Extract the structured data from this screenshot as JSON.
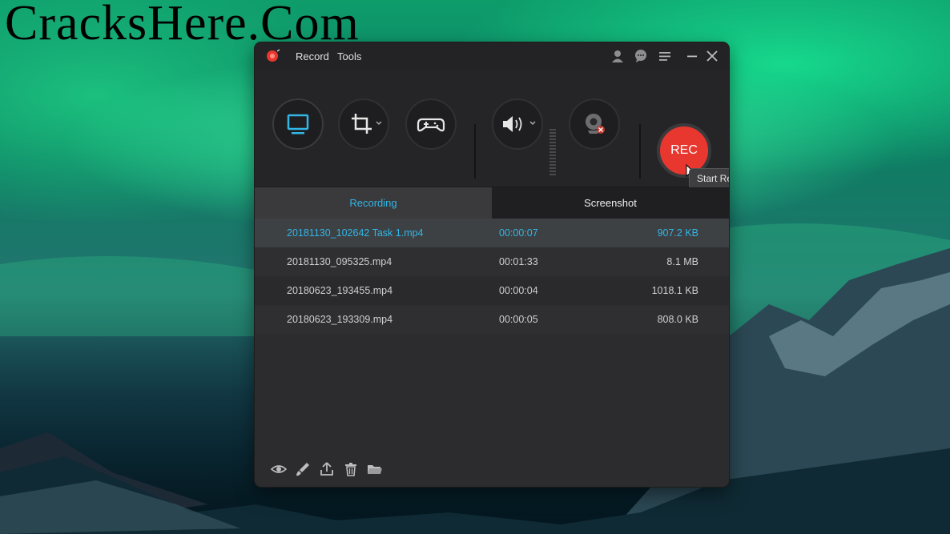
{
  "watermark": "CracksHere.Com",
  "app": {
    "menu": [
      "Record",
      "Tools"
    ]
  },
  "toolbar": {
    "rec_label": "REC",
    "tooltip": "Start Recording (Ctrl+Shift+R)"
  },
  "tabs": [
    {
      "label": "Recording",
      "active": true
    },
    {
      "label": "Screenshot",
      "active": false
    }
  ],
  "files": [
    {
      "name": "20181130_102642 Task 1.mp4",
      "duration": "00:00:07",
      "size": "907.2 KB",
      "selected": true
    },
    {
      "name": "20181130_095325.mp4",
      "duration": "00:01:33",
      "size": "8.1 MB",
      "selected": false
    },
    {
      "name": "20180623_193455.mp4",
      "duration": "00:00:04",
      "size": "1018.1 KB",
      "selected": false
    },
    {
      "name": "20180623_193309.mp4",
      "duration": "00:00:05",
      "size": "808.0 KB",
      "selected": false
    }
  ],
  "colors": {
    "accent": "#33b5e5",
    "rec": "#e8372f"
  },
  "icons": {
    "titlebar": [
      "account-icon",
      "chat-icon",
      "menu-icon",
      "minimize-icon",
      "close-icon"
    ],
    "toolbar": [
      "monitor-icon",
      "crop-icon",
      "gamepad-icon",
      "speaker-icon",
      "webcam-icon"
    ],
    "bottom": [
      "preview-icon",
      "edit-icon",
      "share-icon",
      "delete-icon",
      "folder-icon"
    ]
  }
}
